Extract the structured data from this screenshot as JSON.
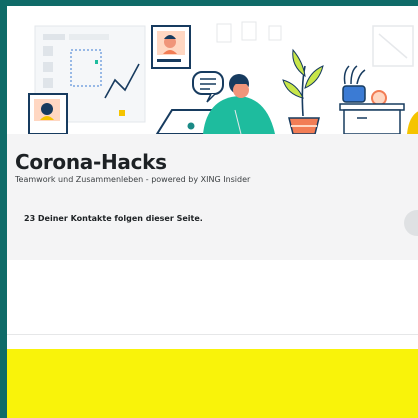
{
  "page": {
    "title": "Corona-Hacks",
    "subtitle": "Teamwork und Zusammenleben - powered by XING Insider",
    "contacts_text": "23 Deiner Kontakte folgen dieser Seite."
  },
  "colors": {
    "frame_border": "#0f6b68",
    "header_bg": "#f4f4f5",
    "accent_yellow": "#f9f30a",
    "illustration_teal": "#1ebc9e",
    "illustration_navy": "#173b5f"
  },
  "icons": [
    "avatar-card-icon",
    "chart-board-icon",
    "chat-bubble-icon",
    "person-laptop-icon",
    "plant-icon",
    "clock-icon",
    "letter-icon"
  ]
}
